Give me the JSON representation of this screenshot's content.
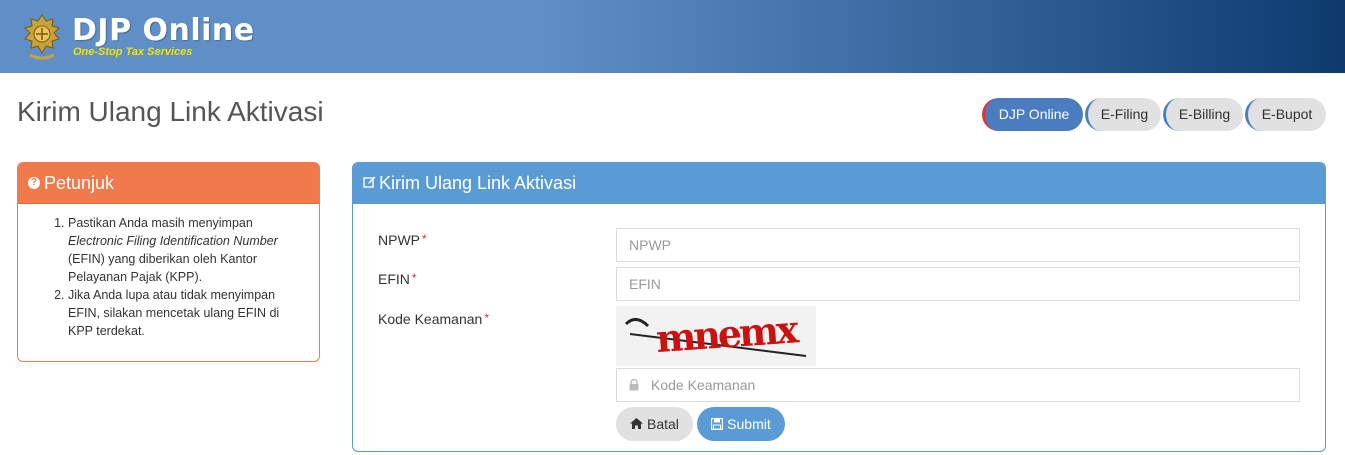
{
  "header": {
    "brand": "DJP Online",
    "tagline": "One-Stop Tax Services"
  },
  "page_title": "Kirim Ulang Link Aktivasi",
  "nav": {
    "items": [
      {
        "label": "DJP Online",
        "active": true
      },
      {
        "label": "E-Filing",
        "active": false
      },
      {
        "label": "E-Billing",
        "active": false
      },
      {
        "label": "E-Bupot",
        "active": false
      }
    ]
  },
  "help_panel": {
    "title": "Petunjuk",
    "icon": "question-circle-icon",
    "item1_pre": "Pastikan Anda masih menyimpan ",
    "item1_em": "Electronic Filing Identification Number",
    "item1_post": " (EFIN) yang diberikan oleh Kantor Pelayanan Pajak (KPP).",
    "item2": "Jika Anda lupa atau tidak menyimpan EFIN, silakan mencetak ulang EFIN di KPP terdekat."
  },
  "form_panel": {
    "title": "Kirim Ulang Link Aktivasi",
    "icon": "edit-icon",
    "npwp_label": "NPWP",
    "npwp_placeholder": "NPWP",
    "efin_label": "EFIN",
    "efin_placeholder": "EFIN",
    "captcha_label": "Kode Keamanan",
    "captcha_text": "mnemx",
    "captcha_placeholder": "Kode Keamanan",
    "required_mark": "*",
    "cancel_label": "Batal",
    "submit_label": "Submit"
  },
  "colors": {
    "header_start": "#5f8fc6",
    "header_end": "#0e3a6e",
    "help_accent": "#f07a4c",
    "form_accent": "#5b9bd5",
    "active_pill": "#4a7cc0",
    "tagline": "#f2e600"
  }
}
